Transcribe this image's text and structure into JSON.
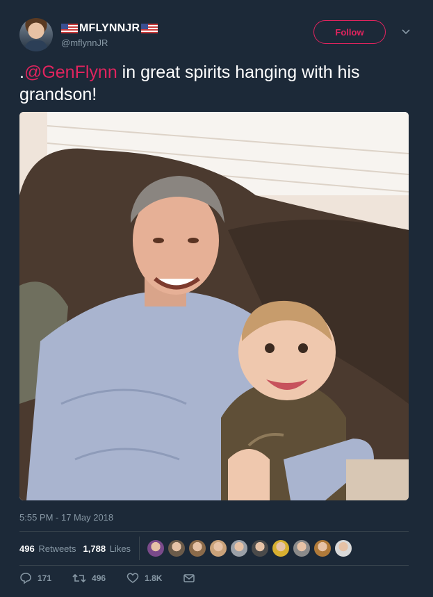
{
  "user": {
    "display_name": "MFLYNNJR",
    "handle": "@mflynnJR"
  },
  "follow_label": "Follow",
  "tweet": {
    "prefix": ".",
    "mention": "@GenFlynn",
    "text": " in great spirits hanging with his grandson!"
  },
  "timestamp": "5:55 PM - 17 May 2018",
  "stats": {
    "retweets_count": "496",
    "retweets_label": "Retweets",
    "likes_count": "1,788",
    "likes_label": "Likes"
  },
  "likers": [
    "#7a4a8a",
    "#6b5b4a",
    "#8a6a4a",
    "#c9a27a",
    "#9aa0a8",
    "#4a4a4a",
    "#d8b030",
    "#8a8a8a",
    "#b07a3a",
    "#d9d9d9"
  ],
  "actions": {
    "replies": "171",
    "retweets": "496",
    "likes": "1.8K"
  },
  "colors": {
    "background": "#1c2938",
    "accent": "#e0245e",
    "muted": "#8899a6"
  },
  "icons": [
    "us-flag-icon",
    "chevron-down-icon",
    "reply-icon",
    "retweet-icon",
    "heart-icon",
    "direct-message-icon"
  ]
}
